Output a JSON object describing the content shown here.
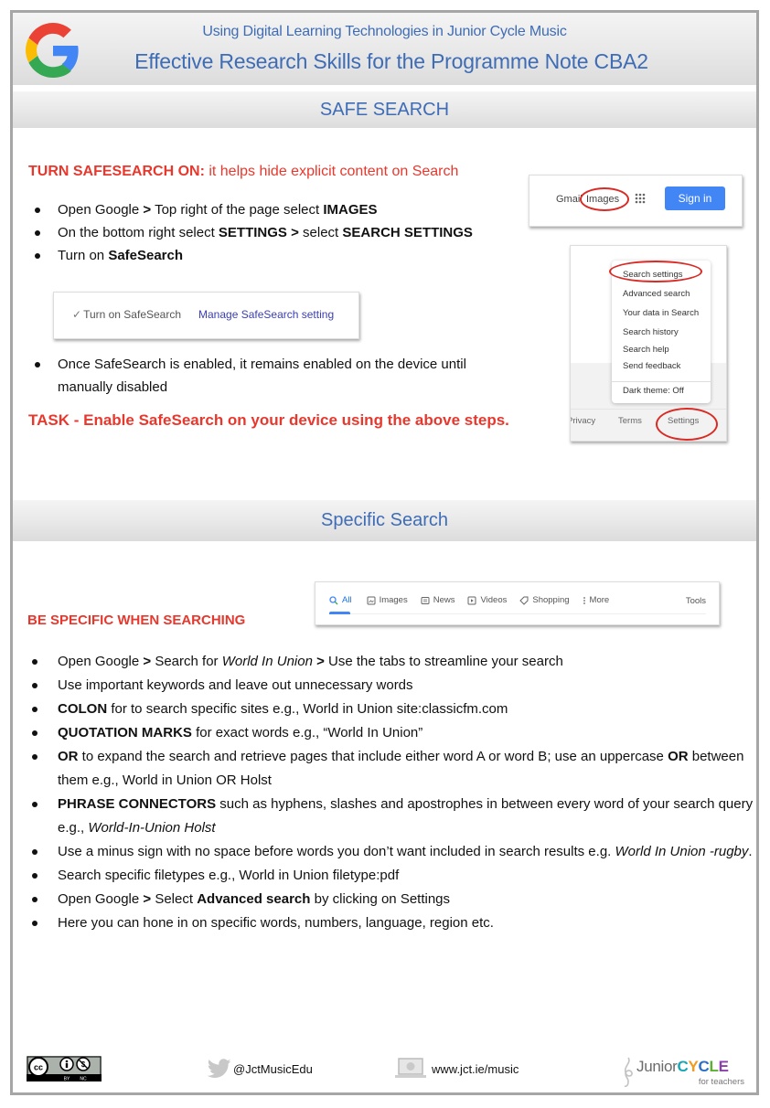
{
  "header": {
    "subtitle": "Using Digital Learning Technologies in Junior Cycle Music",
    "title": "Effective Research Skills for the Programme Note CBA2",
    "logo_icon": "google-g-logo"
  },
  "safe_search": {
    "section_title": "SAFE SEARCH",
    "heading_bold": "TURN SAFESEARCH ON:",
    "heading_rest": " it helps hide explicit content on Search",
    "steps": [
      {
        "parts": [
          {
            "t": "Open Google ",
            "b": false
          },
          {
            "t": ">",
            "b": true
          },
          {
            "t": " Top right of the page select ",
            "b": false
          },
          {
            "t": "IMAGES",
            "b": true
          }
        ]
      },
      {
        "parts": [
          {
            "t": "On the bottom right select ",
            "b": false
          },
          {
            "t": "SETTINGS >",
            "b": true
          },
          {
            "t": " select ",
            "b": false
          },
          {
            "t": "SEARCH SETTINGS",
            "b": true
          }
        ]
      },
      {
        "parts": [
          {
            "t": "Turn on ",
            "b": false
          },
          {
            "t": "SafeSearch",
            "b": true
          }
        ]
      }
    ],
    "note": "Once SafeSearch is enabled, it remains enabled on the device until manually disabled",
    "task": "TASK - Enable SafeSearch on your device using the above steps.",
    "topbar_shot": {
      "gmail": "Gmail",
      "images": "Images",
      "apps_icon": "apps-grid-icon",
      "sign_in": "Sign in"
    },
    "checkbox_shot": {
      "checkbox_label": "Turn on SafeSearch",
      "checked": true,
      "link": "Manage SafeSearch setting"
    },
    "settings_menu_shot": {
      "menu_items": [
        "Search settings",
        "Advanced search",
        "Your data in Search",
        "Search history",
        "Search help",
        "Send feedback"
      ],
      "dark_theme": "Dark theme: Off",
      "footer_links": [
        "Privacy",
        "Terms",
        "Settings"
      ]
    }
  },
  "specific_search": {
    "section_title": "Specific Search",
    "heading": "BE SPECIFIC WHEN SEARCHING",
    "tabs_shot": {
      "tabs": [
        {
          "label": "All",
          "icon": "search-icon",
          "active": true
        },
        {
          "label": "Images",
          "icon": "image-icon",
          "active": false
        },
        {
          "label": "News",
          "icon": "news-icon",
          "active": false
        },
        {
          "label": "Videos",
          "icon": "video-icon",
          "active": false
        },
        {
          "label": "Shopping",
          "icon": "tag-icon",
          "active": false
        },
        {
          "label": "More",
          "icon": "more-vert-icon",
          "active": false
        }
      ],
      "tools": "Tools"
    },
    "tips": [
      {
        "parts": [
          {
            "t": "Open Google ",
            "s": "n"
          },
          {
            "t": ">",
            "s": "b"
          },
          {
            "t": " Search for ",
            "s": "n"
          },
          {
            "t": "World In Union",
            "s": "i"
          },
          {
            "t": " ",
            "s": "n"
          },
          {
            "t": ">",
            "s": "b"
          },
          {
            "t": " Use the tabs to streamline your search",
            "s": "n"
          }
        ]
      },
      {
        "parts": [
          {
            "t": "Use important keywords and leave out unnecessary words",
            "s": "n"
          }
        ]
      },
      {
        "parts": [
          {
            "t": "COLON",
            "s": "b"
          },
          {
            "t": " for to search specific sites e.g., World in Union site:classicfm.com",
            "s": "n"
          }
        ]
      },
      {
        "parts": [
          {
            "t": "QUOTATION MARKS",
            "s": "b"
          },
          {
            "t": " for exact words e.g., “World In Union”",
            "s": "n"
          }
        ]
      },
      {
        "parts": [
          {
            "t": "OR",
            "s": "b"
          },
          {
            "t": " to expand the search and retrieve pages that include either word A or word B; use an uppercase ",
            "s": "n"
          },
          {
            "t": "OR",
            "s": "b"
          },
          {
            "t": " between them e.g., World in Union OR Holst",
            "s": "n"
          }
        ]
      },
      {
        "parts": [
          {
            "t": "PHRASE CONNECTORS",
            "s": "b"
          },
          {
            "t": " such as hyphens, slashes and apostrophes in between every word of your search query e.g., ",
            "s": "n"
          },
          {
            "t": "World-In-Union Holst",
            "s": "i"
          }
        ]
      },
      {
        "parts": [
          {
            "t": "Use a minus sign with no space before words you don’t want included in search results e.g. ",
            "s": "n"
          },
          {
            "t": "World In Union -rugby",
            "s": "i"
          },
          {
            "t": ".",
            "s": "n"
          }
        ]
      },
      {
        "parts": [
          {
            "t": "Search specific filetypes e.g., World in Union filetype:pdf",
            "s": "n"
          }
        ]
      },
      {
        "parts": [
          {
            "t": "Open Google ",
            "s": "n"
          },
          {
            "t": ">",
            "s": "b"
          },
          {
            "t": " Select ",
            "s": "n"
          },
          {
            "t": "Advanced search",
            "s": "b"
          },
          {
            "t": "  by clicking on Settings",
            "s": "n"
          }
        ]
      },
      {
        "parts": [
          {
            "t": "Here you can hone in on specific words, numbers, language, region etc.",
            "s": "n"
          }
        ]
      }
    ]
  },
  "footer": {
    "license_icon": "cc-by-nc-icon",
    "license_labels": [
      "BY",
      "NC"
    ],
    "twitter_icon": "twitter-bird-icon",
    "twitter": "@JctMusicEdu",
    "web_icon": "laptop-globe-icon",
    "website": "www.jct.ie/music",
    "brand_junior": "Junior",
    "brand_cycle_letters": [
      {
        "l": "C",
        "color": "#1aa6b7"
      },
      {
        "l": "Y",
        "color": "#f39a1e"
      },
      {
        "l": "C",
        "color": "#2a6fc9"
      },
      {
        "l": "L",
        "color": "#5bb030"
      },
      {
        "l": "E",
        "color": "#8b3fa8"
      }
    ],
    "brand_tagline": "for teachers"
  },
  "colors": {
    "heading_blue": "#3e6cb5",
    "alert_red": "#e8382d",
    "google_blue": "#4285f4",
    "google_red": "#ea4335",
    "google_yellow": "#fbbc05",
    "google_green": "#34a853"
  }
}
